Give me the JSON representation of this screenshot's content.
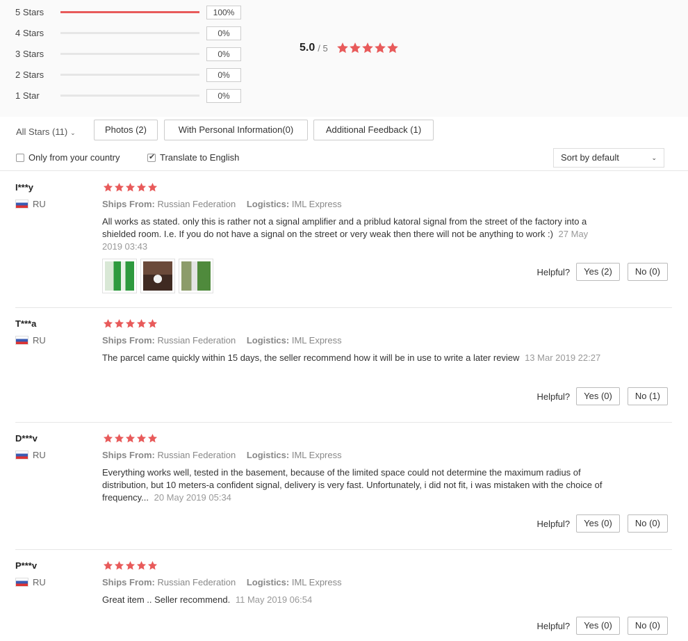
{
  "rating_distribution": [
    {
      "label": "5 Stars",
      "percent": "100%",
      "fill": 1.0
    },
    {
      "label": "4 Stars",
      "percent": "0%",
      "fill": 0
    },
    {
      "label": "3 Stars",
      "percent": "0%",
      "fill": 0
    },
    {
      "label": "2 Stars",
      "percent": "0%",
      "fill": 0
    },
    {
      "label": "1 Star",
      "percent": "0%",
      "fill": 0
    }
  ],
  "average": {
    "score": "5.0",
    "max": "/ 5",
    "stars": 5
  },
  "colors": {
    "star": "#e85a5a",
    "bar_fill": "#e85a5a"
  },
  "filters": {
    "all_stars": "All Stars (11)",
    "photos": "Photos (2)",
    "personal_info": "With Personal Information(0)",
    "additional_feedback": "Additional Feedback (1)",
    "only_country": "Only from your country",
    "only_country_checked": false,
    "translate": "Translate to English",
    "translate_checked": true,
    "sort": "Sort by default"
  },
  "labels": {
    "ships_from": "Ships From:",
    "logistics": "Logistics:",
    "helpful": "Helpful?"
  },
  "reviews": [
    {
      "user": "I***y",
      "country": "RU",
      "stars": 5,
      "ships_from": "Russian Federation",
      "logistics": "IML Express",
      "text": "All works as stated. only this is rather not a signal amplifier and a priblud katoral signal from the street of the factory into a shielded room. I.e. If you do not have a signal on the street or very weak then there will not be anything to work :)",
      "date": "27 May 2019 03:43",
      "yes": "Yes (2)",
      "no": "No (0)",
      "photos": [
        "photo-1",
        "photo-2",
        "photo-3"
      ]
    },
    {
      "user": "T***a",
      "country": "RU",
      "stars": 5,
      "ships_from": "Russian Federation",
      "logistics": "IML Express",
      "text": "The parcel came quickly within 15 days, the seller recommend how it will be in use to write a later review",
      "date": "13 Mar 2019 22:27",
      "yes": "Yes (0)",
      "no": "No (1)"
    },
    {
      "user": "D***v",
      "country": "RU",
      "stars": 5,
      "ships_from": "Russian Federation",
      "logistics": "IML Express",
      "text": "Everything works well, tested in the basement, because of the limited space could not determine the maximum radius of distribution, but 10 meters-a confident signal, delivery is very fast. Unfortunately, i did not fit, i was mistaken with the choice of frequency...",
      "date": "20 May 2019 05:34",
      "yes": "Yes (0)",
      "no": "No (0)"
    },
    {
      "user": "P***v",
      "country": "RU",
      "stars": 5,
      "ships_from": "Russian Federation",
      "logistics": "IML Express",
      "text": "Great item .. Seller recommend.",
      "date": "11 May 2019 06:54",
      "yes": "Yes (0)",
      "no": "No (0)"
    }
  ]
}
